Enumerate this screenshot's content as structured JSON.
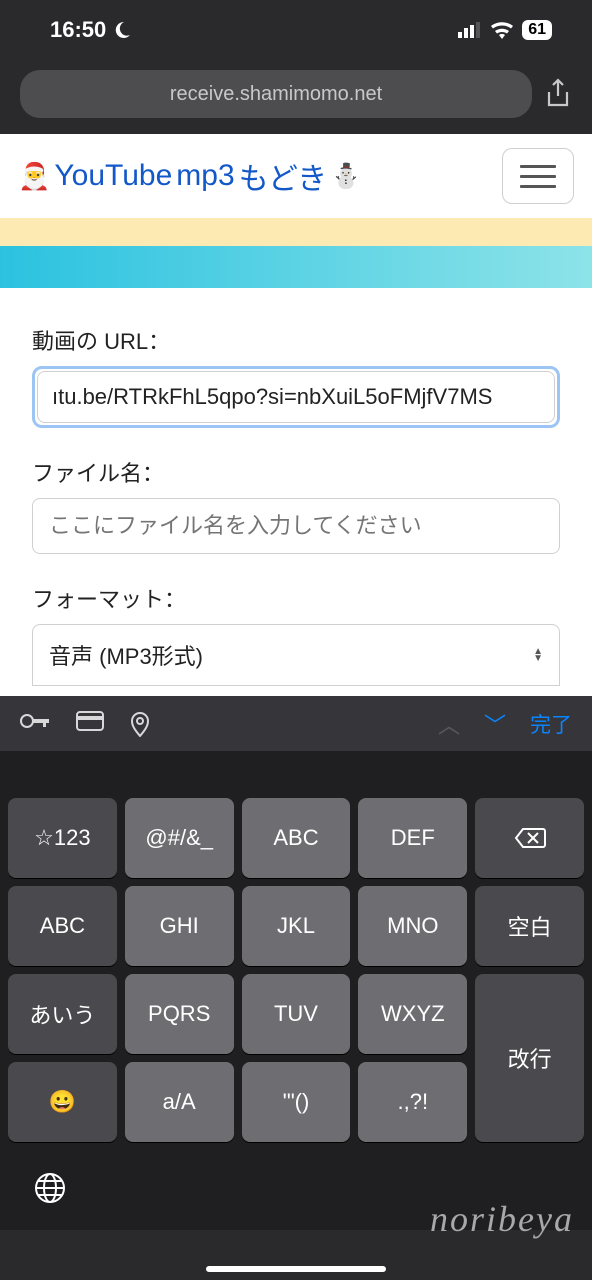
{
  "status": {
    "time": "16:50",
    "battery": "61"
  },
  "browser": {
    "url": "receive.shamimomo.net"
  },
  "header": {
    "logo_youtube": "YouTube",
    "logo_mp3": "mp3",
    "logo_jp": "もどき"
  },
  "form": {
    "url_label": "動画の URL：",
    "url_value": "ıtu.be/RTRkFhL5qpo?si=nbXuiL5oFMjfV7MS",
    "filename_label": "ファイル名：",
    "filename_placeholder": "ここにファイル名を入力してください",
    "format_label": "フォーマット：",
    "format_value": "音声 (MP3形式)"
  },
  "keyboard": {
    "done": "完了",
    "keys": {
      "r1": [
        "☆123",
        "@#/&_",
        "ABC",
        "DEF"
      ],
      "r2": [
        "ABC",
        "GHI",
        "JKL",
        "MNO",
        "空白"
      ],
      "r3": [
        "あいう",
        "PQRS",
        "TUV",
        "WXYZ"
      ],
      "r4": [
        "a/A",
        "'\"()",
        ".,?!"
      ],
      "enter": "改行"
    }
  },
  "watermark": "noribeya"
}
